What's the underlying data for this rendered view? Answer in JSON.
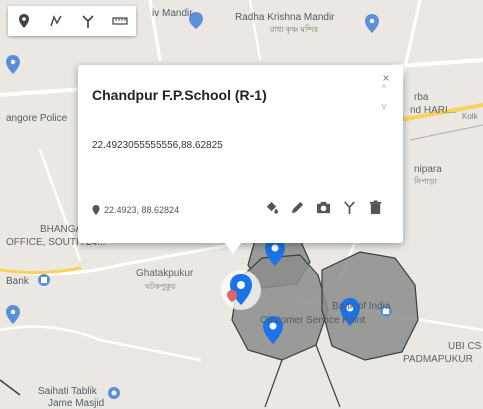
{
  "map": {
    "labels": {
      "jiv_mandir": "iv Mandir",
      "radha_krishna": "Radha Krishna Mandir",
      "radha_krishna_bn": "রাধা কৃষ্ণ মন্দির",
      "tangore_police": "angore Police",
      "rba": "rba",
      "nd_hari": "nd HARI...",
      "kolk": "Kolk",
      "nipara": "nipara",
      "nipara_bn": "নিপাড়া",
      "bhanga": "BHANGA",
      "office_south": "OFFICE, SOUTH 24...",
      "bank": "Bank",
      "ghatakpukur": "Ghatakpukur",
      "ghatakpukur_bn": "ঘটকপুকুর",
      "bank_of_india": "Bank of India",
      "customer_service": "Customer Service Point",
      "ubi": "UBI CS",
      "padmapukur": "PADMAPUKUR",
      "saihati": "Saihati Tablik",
      "jame_masjid": "Jame Masjid"
    }
  },
  "toolbar": {
    "tools": [
      {
        "name": "marker-tool",
        "icon": "map-pin-icon"
      },
      {
        "name": "polyline-tool",
        "icon": "draw-line-icon"
      },
      {
        "name": "route-tool",
        "icon": "route-fork-icon"
      },
      {
        "name": "measure-tool",
        "icon": "ruler-icon"
      }
    ]
  },
  "popup": {
    "title": "Chandpur F.P.School (R-1)",
    "coords_full": "22.4923055555556,88.62825",
    "latlng": "22.4923, 88.62824",
    "actions": [
      "paint-bucket-icon",
      "pencil-icon",
      "camera-icon",
      "route-fork-icon",
      "trash-icon"
    ],
    "close_glyph": "×",
    "scroll_up_glyph": "^",
    "scroll_down_glyph": "v"
  },
  "colors": {
    "polygon_fill": "#8c8c8c",
    "polygon_stroke": "#3c3c3c",
    "marker_blue": "#1a73e8",
    "poi_blue": "#5b8fd9"
  }
}
